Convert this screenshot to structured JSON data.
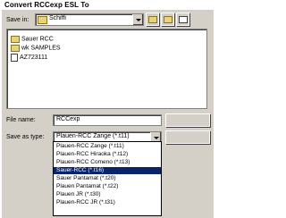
{
  "window": {
    "title": "Convert RCCexp ESL To"
  },
  "save_in": {
    "label": "Save in:",
    "value": "Schiffi"
  },
  "files": [
    {
      "name": "Sauer RCC",
      "icon": "folder-icon"
    },
    {
      "name": "wk SAMPLES",
      "icon": "folder-icon"
    },
    {
      "name": "AZ723111",
      "icon": "document-icon"
    }
  ],
  "file_name": {
    "label": "File name:",
    "value": "RCCexp"
  },
  "save_as_type": {
    "label": "Save as type:",
    "value": "Plauen-RCC Zange (*.t11)",
    "options": [
      {
        "label": "Plauen-RCC Zange (*.t11)",
        "selected": false
      },
      {
        "label": "Plauen-RCC Hiraoka (*.t12)",
        "selected": false
      },
      {
        "label": "Plauen-RCC Comeno (*.t13)",
        "selected": false
      },
      {
        "label": "Sauer-RCC (*.t16)",
        "selected": true
      },
      {
        "label": "Sauer Pantamat (*.t20)",
        "selected": false
      },
      {
        "label": "Plauen Pantamat (*.t22)",
        "selected": false
      },
      {
        "label": "Plauen JR (*.t30)",
        "selected": false
      },
      {
        "label": "Plauen-RCC JR (*.t31)",
        "selected": false
      }
    ]
  }
}
